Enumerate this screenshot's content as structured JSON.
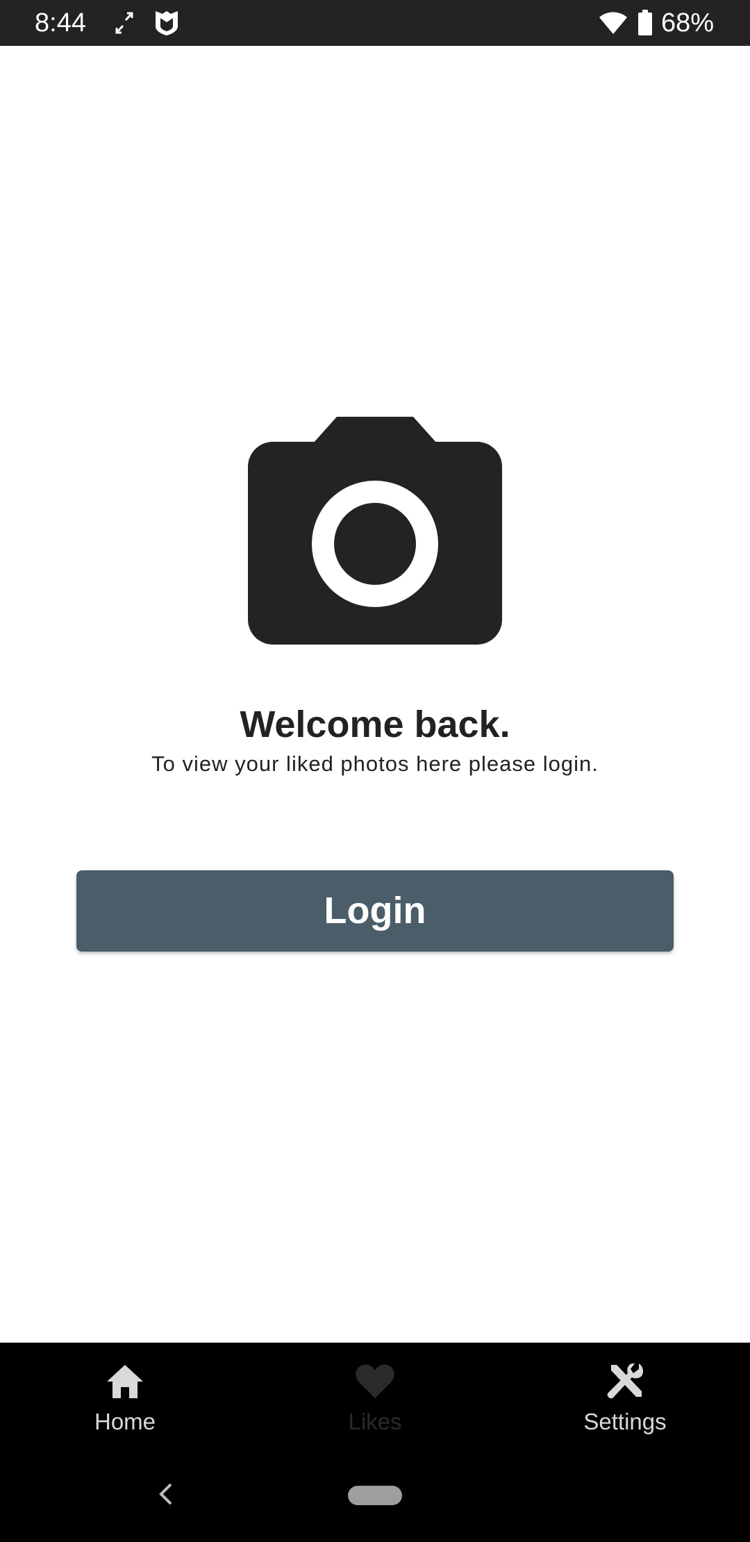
{
  "status_bar": {
    "time": "8:44",
    "battery_percent": "68%",
    "icons": [
      "screen-rotate-icon",
      "shield-icon",
      "wifi-icon",
      "battery-icon"
    ]
  },
  "content": {
    "hero_icon": "camera-icon",
    "title": "Welcome back.",
    "subtitle": "To view your liked photos here please login.",
    "login_label": "Login"
  },
  "bottom_nav": {
    "items": [
      {
        "label": "Home",
        "icon": "home-icon",
        "color": "#d9d9d9"
      },
      {
        "label": "Likes",
        "icon": "heart-icon",
        "color": "#2a2a2a",
        "selected": true
      },
      {
        "label": "Settings",
        "icon": "tools-icon",
        "color": "#d9d9d9"
      }
    ]
  },
  "colors": {
    "status_bar_bg": "#232323",
    "icon_dark": "#232323",
    "button_bg": "#4a5d69",
    "nav_bg": "#000000"
  }
}
